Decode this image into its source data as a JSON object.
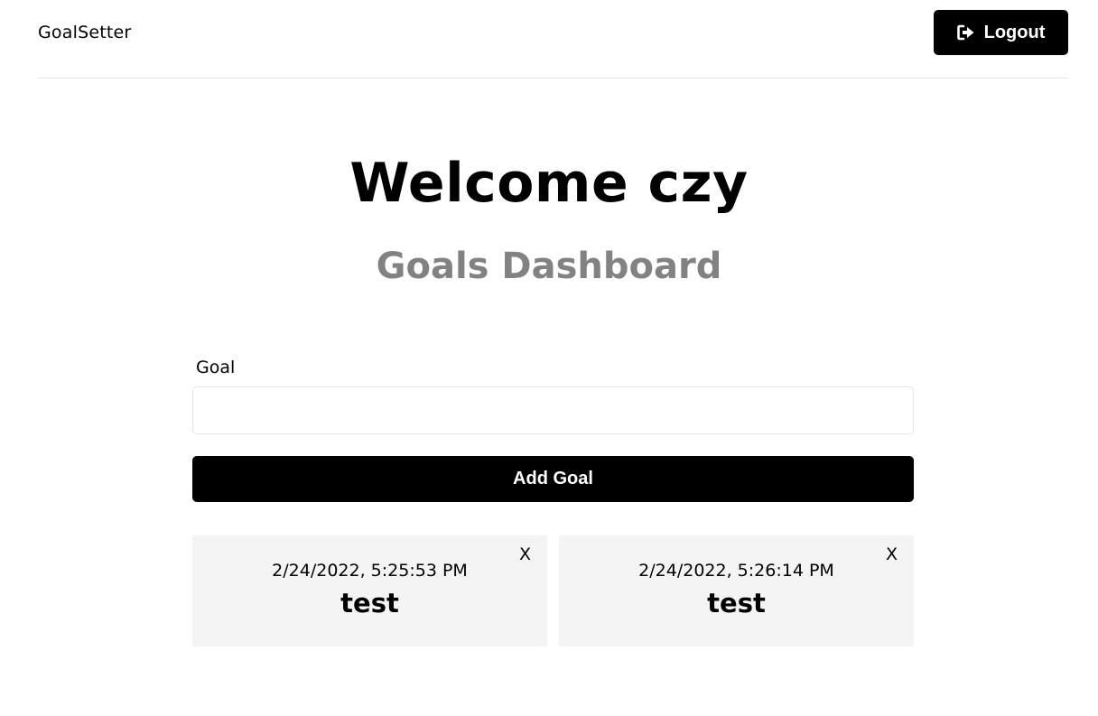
{
  "header": {
    "logo": "GoalSetter",
    "logout_label": "Logout",
    "logout_icon": "sign-out-icon"
  },
  "main": {
    "welcome": "Welcome czy",
    "subtitle": "Goals Dashboard"
  },
  "form": {
    "goal_label": "Goal",
    "goal_value": "",
    "goal_placeholder": "",
    "add_button": "Add Goal"
  },
  "goals": [
    {
      "date": "2/24/2022, 5:25:53 PM",
      "text": "test",
      "close": "X"
    },
    {
      "date": "2/24/2022, 5:26:14 PM",
      "text": "test",
      "close": "X"
    }
  ],
  "colors": {
    "primary": "#000000",
    "subtitle": "#828282",
    "card_bg": "#f4f4f4",
    "border": "#e6e6e6"
  }
}
